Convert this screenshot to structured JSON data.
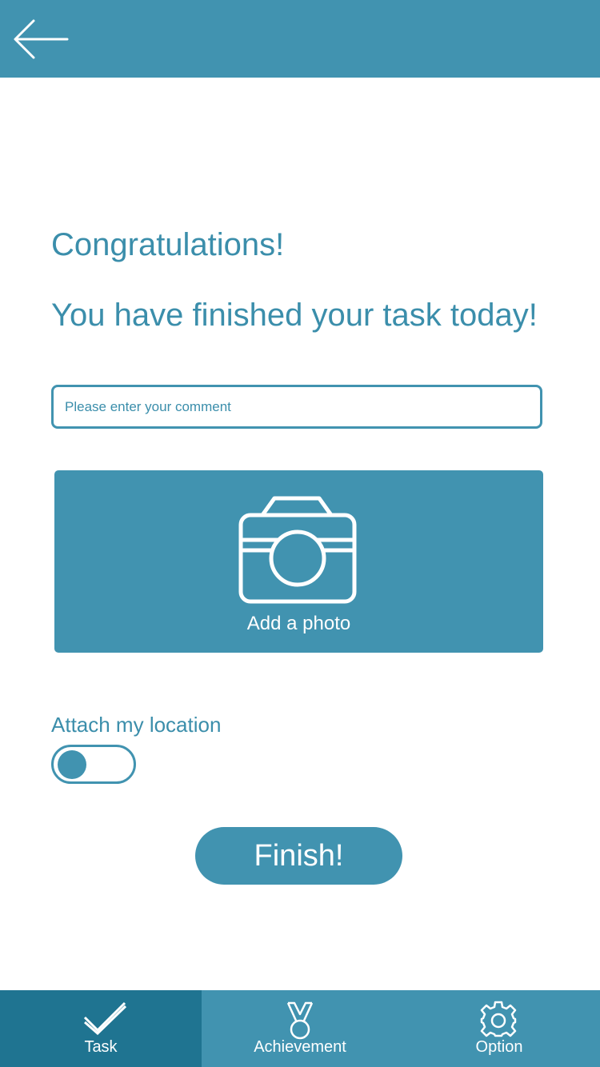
{
  "colors": {
    "primary": "#4193b0",
    "primary_dark": "#1f7491",
    "text_accent": "#3b8eab",
    "background": "#ffffff"
  },
  "header": {
    "back_icon": "arrow-left-icon"
  },
  "main": {
    "heading": "Congratulations!",
    "subheading": "You have finished your task today!",
    "comment": {
      "placeholder": "Please enter your comment",
      "value": ""
    },
    "photo": {
      "icon": "camera-icon",
      "label": "Add a photo"
    },
    "location": {
      "label": "Attach my location",
      "enabled": false
    },
    "finish_label": "Finish!"
  },
  "bottom_nav": {
    "active": "Task",
    "items": [
      {
        "label": "Task",
        "icon": "checkmark-icon"
      },
      {
        "label": "Achievement",
        "icon": "medal-icon"
      },
      {
        "label": "Option",
        "icon": "gear-icon"
      }
    ]
  }
}
